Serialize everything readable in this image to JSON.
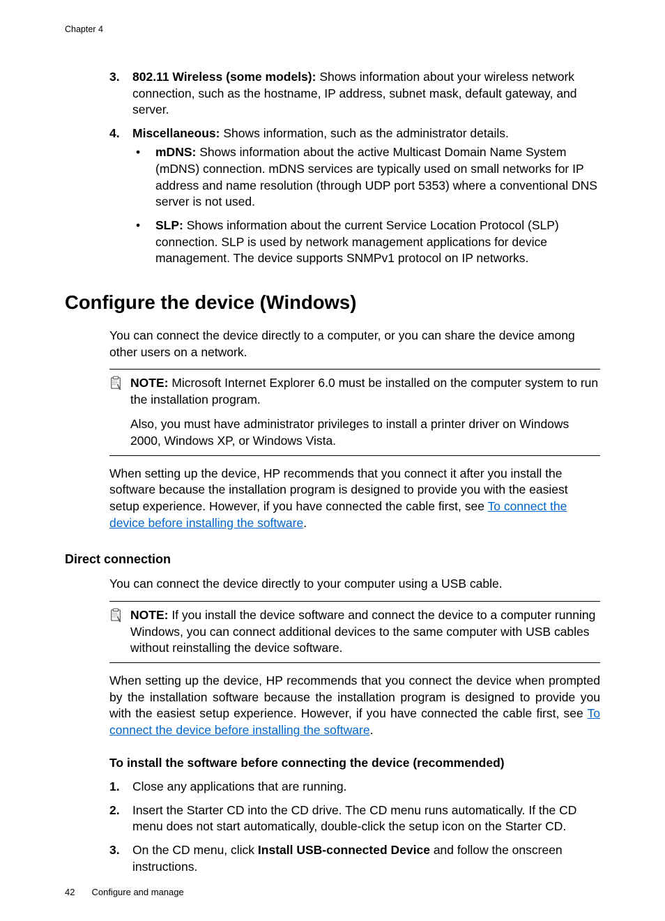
{
  "header": "Chapter 4",
  "list1": {
    "n3": "3.",
    "n3_lead": "802.11 Wireless (some models):",
    "n3_text": " Shows information about your wireless network connection, such as the hostname, IP address, subnet mask, default gateway, and server.",
    "n4": "4.",
    "n4_lead": "Miscellaneous:",
    "n4_text": " Shows information, such as the administrator details.",
    "b1_lead": "mDNS:",
    "b1_text": " Shows information about the active Multicast Domain Name System (mDNS) connection. mDNS services are typically used on small networks for IP address and name resolution (through UDP port 5353) where a conventional DNS server is not used.",
    "b2_lead": "SLP:",
    "b2_text": " Shows information about the current Service Location Protocol (SLP) connection. SLP is used by network management applications for device management. The device supports SNMPv1 protocol on IP networks."
  },
  "h1": "Configure the device (Windows)",
  "p1": "You can connect the device directly to a computer, or you can share the device among other users on a network.",
  "note1": {
    "lead": "NOTE:",
    "p1": " Microsoft Internet Explorer 6.0 must be installed on the computer system to run the installation program.",
    "p2": "Also, you must have administrator privileges to install a printer driver on Windows 2000, Windows XP, or Windows Vista."
  },
  "p2_a": "When setting up the device, HP recommends that you connect it after you install the software because the installation program is designed to provide you with the easiest setup experience. However, if you have connected the cable first, see ",
  "p2_link": "To connect the device before installing the software",
  "p2_b": ".",
  "h2": "Direct connection",
  "p3": "You can connect the device directly to your computer using a USB cable.",
  "note2": {
    "lead": "NOTE:",
    "p1": " If you install the device software and connect the device to a computer running Windows, you can connect additional devices to the same computer with USB cables without reinstalling the device software."
  },
  "p4_a": "When setting up the device, HP recommends that you connect the device when prompted by the installation software because the installation program is designed to provide you with the easiest setup experience. However, if you have connected the cable first, see ",
  "p4_link": "To connect the device before installing the software",
  "p4_b": ".",
  "h3": "To install the software before connecting the device (recommended)",
  "list2": {
    "n1": "1.",
    "n1_text": "Close any applications that are running.",
    "n2": "2.",
    "n2_text": "Insert the Starter CD into the CD drive. The CD menu runs automatically. If the CD menu does not start automatically, double-click the setup icon on the Starter CD.",
    "n3": "3.",
    "n3_a": "On the CD menu, click ",
    "n3_bold": "Install USB-connected Device",
    "n3_b": " and follow the onscreen instructions."
  },
  "footer": {
    "page": "42",
    "section": "Configure and manage"
  }
}
